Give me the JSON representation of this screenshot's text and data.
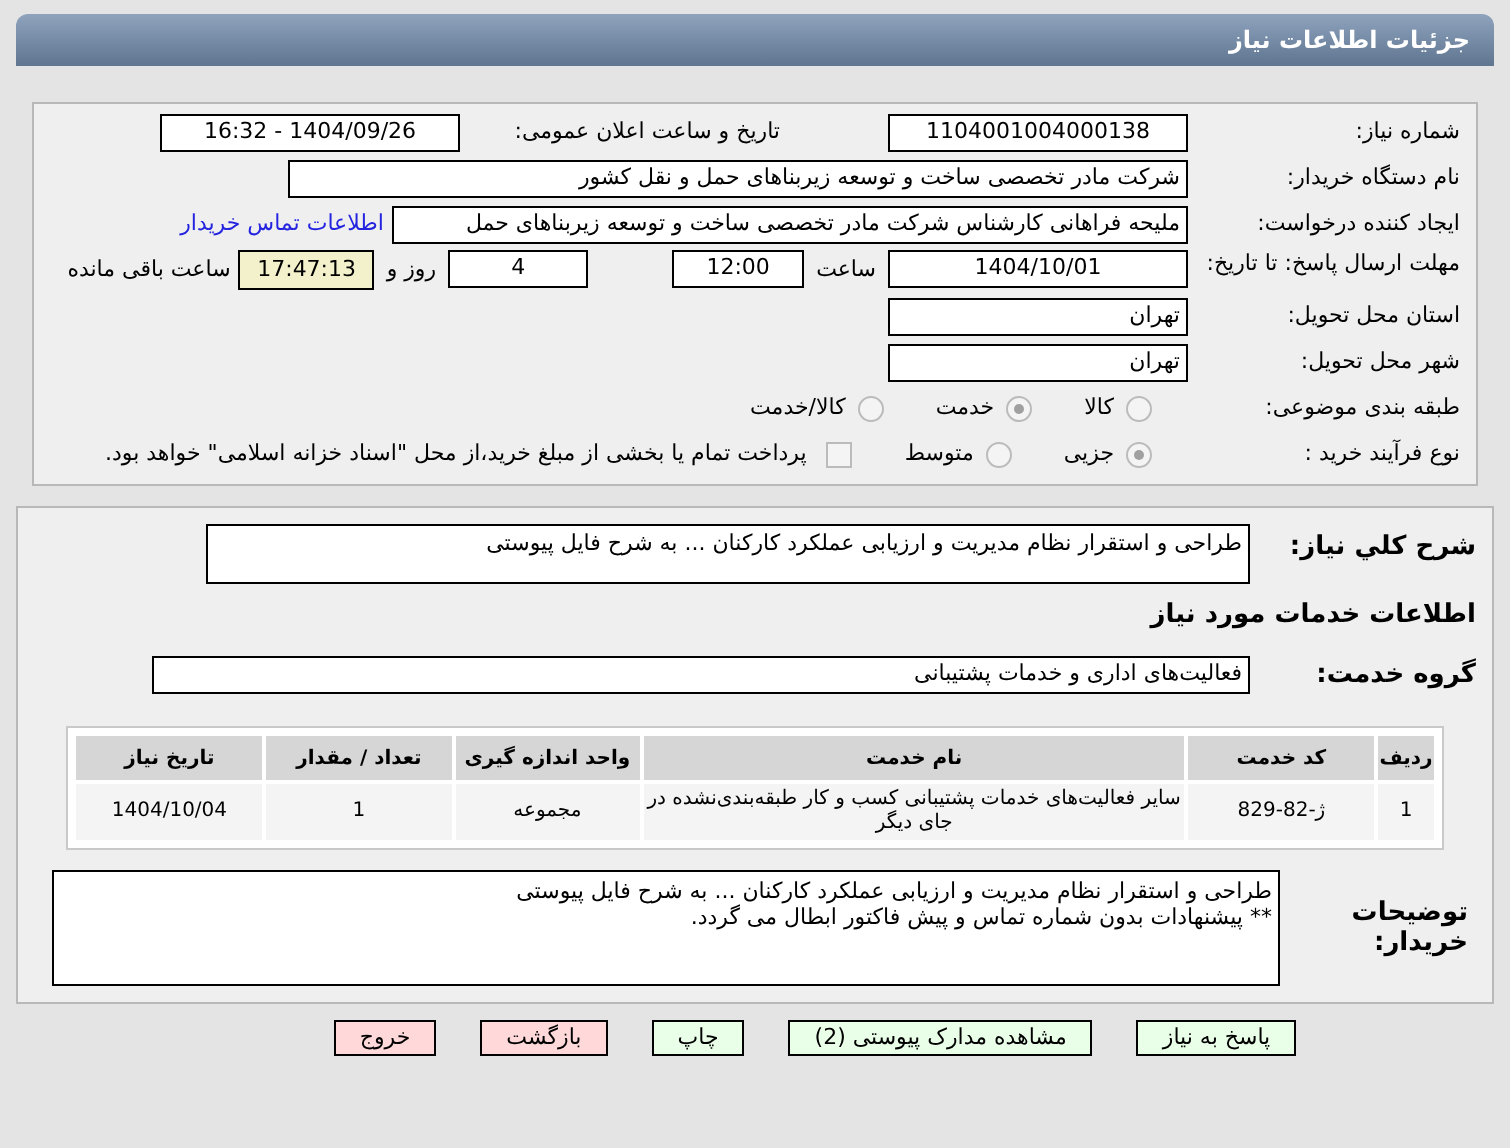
{
  "header": {
    "title": "جزئيات اطلاعات نياز"
  },
  "details": {
    "need_number": {
      "label": "شماره نیاز:",
      "value": "1104001004000138"
    },
    "announce": {
      "label": "تاریخ و ساعت اعلان عمومی:",
      "value": "1404/09/26 - 16:32"
    },
    "buyer": {
      "label": "نام دستگاه خریدار:",
      "value": "شرکت مادر تخصصی ساخت و توسعه زیربناهای حمل و نقل کشور"
    },
    "creator": {
      "label": "ایجاد کننده درخواست:",
      "value": "ملیحه فراهانی کارشناس شرکت مادر تخصصی ساخت و توسعه زیربناهای حمل",
      "link": "اطلاعات تماس خریدار"
    },
    "deadline": {
      "label": "مهلت ارسال پاسخ: تا تاریخ:",
      "date": "1404/10/01",
      "time_label": "ساعت",
      "time": "12:00",
      "days": "4",
      "days_label": "روز و",
      "remaining": "17:47:13",
      "remaining_label": "ساعت باقی مانده"
    },
    "province": {
      "label": "استان محل تحویل:",
      "value": "تهران"
    },
    "city": {
      "label": "شهر محل تحویل:",
      "value": "تهران"
    },
    "category": {
      "label": "طبقه بندی موضوعی:",
      "options": [
        {
          "label": "کالا",
          "selected": false
        },
        {
          "label": "خدمت",
          "selected": true
        },
        {
          "label": "کالا/خدمت",
          "selected": false
        }
      ]
    },
    "process": {
      "label": "نوع فرآیند خرید :",
      "options": [
        {
          "label": "جزیی",
          "selected": true
        },
        {
          "label": "متوسط",
          "selected": false
        }
      ],
      "treasury": {
        "checked": false,
        "text": "پرداخت تمام یا بخشی از مبلغ خرید،از محل \"اسناد خزانه اسلامی\" خواهد بود."
      }
    }
  },
  "services": {
    "summary": {
      "label": "شرح کلي نياز:",
      "value": "طراحی و استقرار نظام مدیریت و ارزیابی عملکرد کارکنان ... به شرح فایل پیوستی"
    },
    "heading": "اطلاعات خدمات مورد نياز",
    "group": {
      "label": "گروه خدمت:",
      "value": "فعالیت‌های اداری و خدمات پشتیبانی"
    },
    "table": {
      "columns": [
        "ردیف",
        "کد خدمت",
        "نام خدمت",
        "واحد اندازه گیری",
        "تعداد / مقدار",
        "تاریخ نیاز"
      ],
      "rows": [
        [
          "1",
          "ژ-82-829",
          "سایر فعالیت‌های خدمات پشتیبانی کسب و کار طبقه‌بندی‌نشده در جای دیگر",
          "مجموعه",
          "1",
          "1404/10/04"
        ]
      ]
    },
    "notes": {
      "label": "توضیحات خریدار:",
      "lines": [
        "طراحی و استقرار نظام مدیریت و ارزیابی عملکرد کارکنان ... به شرح فایل پیوستی",
        "** پیشنهادات بدون شماره تماس و پیش فاکتور ابطال می گردد."
      ]
    }
  },
  "buttons": [
    {
      "label": "پاسخ به نیاز",
      "kind": "action"
    },
    {
      "label": "مشاهده مدارک پیوستی (2)",
      "kind": "action"
    },
    {
      "label": "چاپ",
      "kind": "action"
    },
    {
      "label": "بازگشت",
      "kind": "exit"
    },
    {
      "label": "خروج",
      "kind": "exit"
    }
  ]
}
